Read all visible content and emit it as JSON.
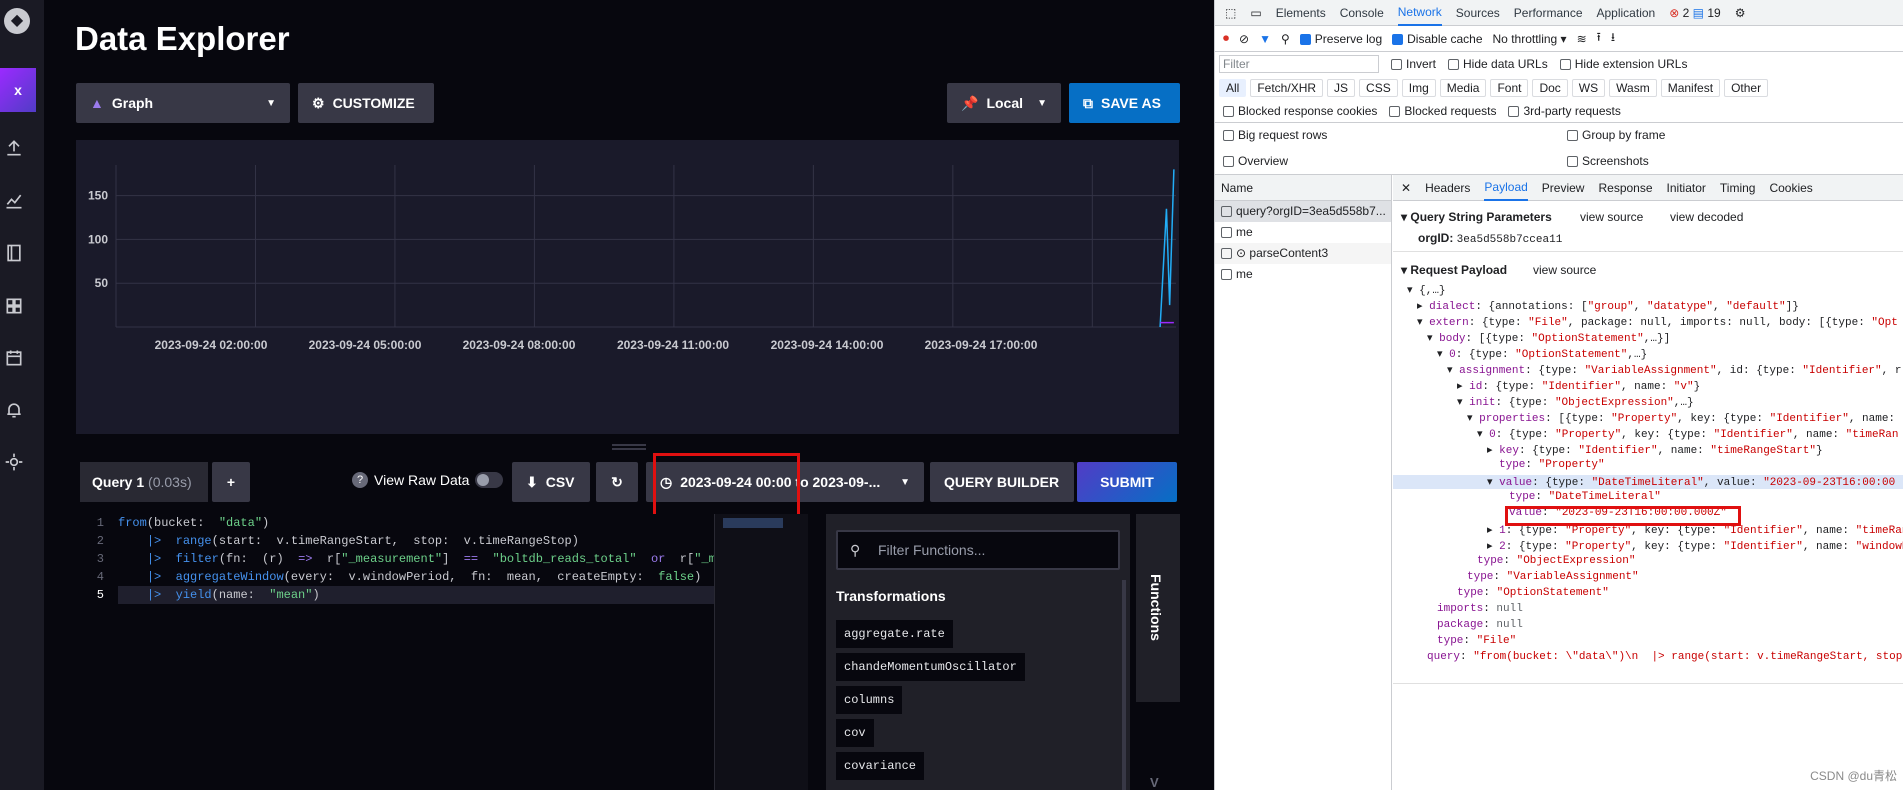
{
  "nav": {
    "active_label": "x"
  },
  "page": {
    "title": "Data Explorer"
  },
  "toolbar": {
    "graph_type": "Graph",
    "customize": "CUSTOMIZE",
    "local": "Local",
    "save_as": "SAVE AS"
  },
  "chart_data": {
    "type": "line",
    "x_ticks": [
      "2023-09-24 02:00:00",
      "2023-09-24 05:00:00",
      "2023-09-24 08:00:00",
      "2023-09-24 11:00:00",
      "2023-09-24 14:00:00",
      "2023-09-24 17:00:00"
    ],
    "y_ticks": [
      "50",
      "100",
      "150"
    ],
    "ylim": [
      0,
      185
    ],
    "series": [
      {
        "color": "#22adf6",
        "points": [
          [
            0.985,
            0
          ],
          [
            0.991,
            135
          ],
          [
            0.994,
            25
          ],
          [
            0.998,
            180
          ]
        ]
      },
      {
        "color": "#9b2aff",
        "points": [
          [
            0.985,
            5
          ],
          [
            0.998,
            5
          ]
        ]
      }
    ]
  },
  "query": {
    "tab": "Query 1",
    "time": "(0.03s)",
    "add": "+",
    "raw_data": "View Raw Data",
    "csv": "CSV",
    "range": "2023-09-24 00:00 to 2023-09-...",
    "builder": "QUERY BUILDER",
    "submit": "SUBMIT"
  },
  "editor": {
    "lines": [
      "1",
      "2",
      "3",
      "4",
      "5"
    ]
  },
  "functions": {
    "search_placeholder": "Filter Functions...",
    "heading": "Transformations",
    "items": [
      "aggregate.rate",
      "chandeMomentumOscillator",
      "columns",
      "cov",
      "covariance"
    ],
    "side": "Functions",
    "side2": "V"
  },
  "devtools": {
    "tabs": [
      "Elements",
      "Console",
      "Network",
      "Sources",
      "Performance",
      "Application"
    ],
    "errors": "2",
    "msgs": "19",
    "preserve": "Preserve log",
    "disable_cache": "Disable cache",
    "throttle": "No throttling",
    "filter": "Filter",
    "invert": "Invert",
    "hide_data": "Hide data URLs",
    "hide_ext": "Hide extension URLs",
    "types": [
      "All",
      "Fetch/XHR",
      "JS",
      "CSS",
      "Img",
      "Media",
      "Font",
      "Doc",
      "WS",
      "Wasm",
      "Manifest",
      "Other"
    ],
    "blocked_resp": "Blocked response cookies",
    "blocked_req": "Blocked requests",
    "third": "3rd-party requests",
    "big_rows": "Big request rows",
    "group_frame": "Group by frame",
    "overview": "Overview",
    "screenshots": "Screenshots",
    "name_col": "Name",
    "requests": [
      "query?orgID=3ea5d558b7...",
      "me",
      "parseContent3",
      "me"
    ],
    "detail_tabs": [
      "Headers",
      "Payload",
      "Preview",
      "Response",
      "Initiator",
      "Timing",
      "Cookies"
    ],
    "qsp": "Query String Parameters",
    "view_source": "view source",
    "view_decoded": "view decoded",
    "orgid_label": "orgID:",
    "orgid_value": "3ea5d558b7ccea11",
    "req_payload": "Request Payload",
    "watermark": "CSDN @du青松"
  }
}
